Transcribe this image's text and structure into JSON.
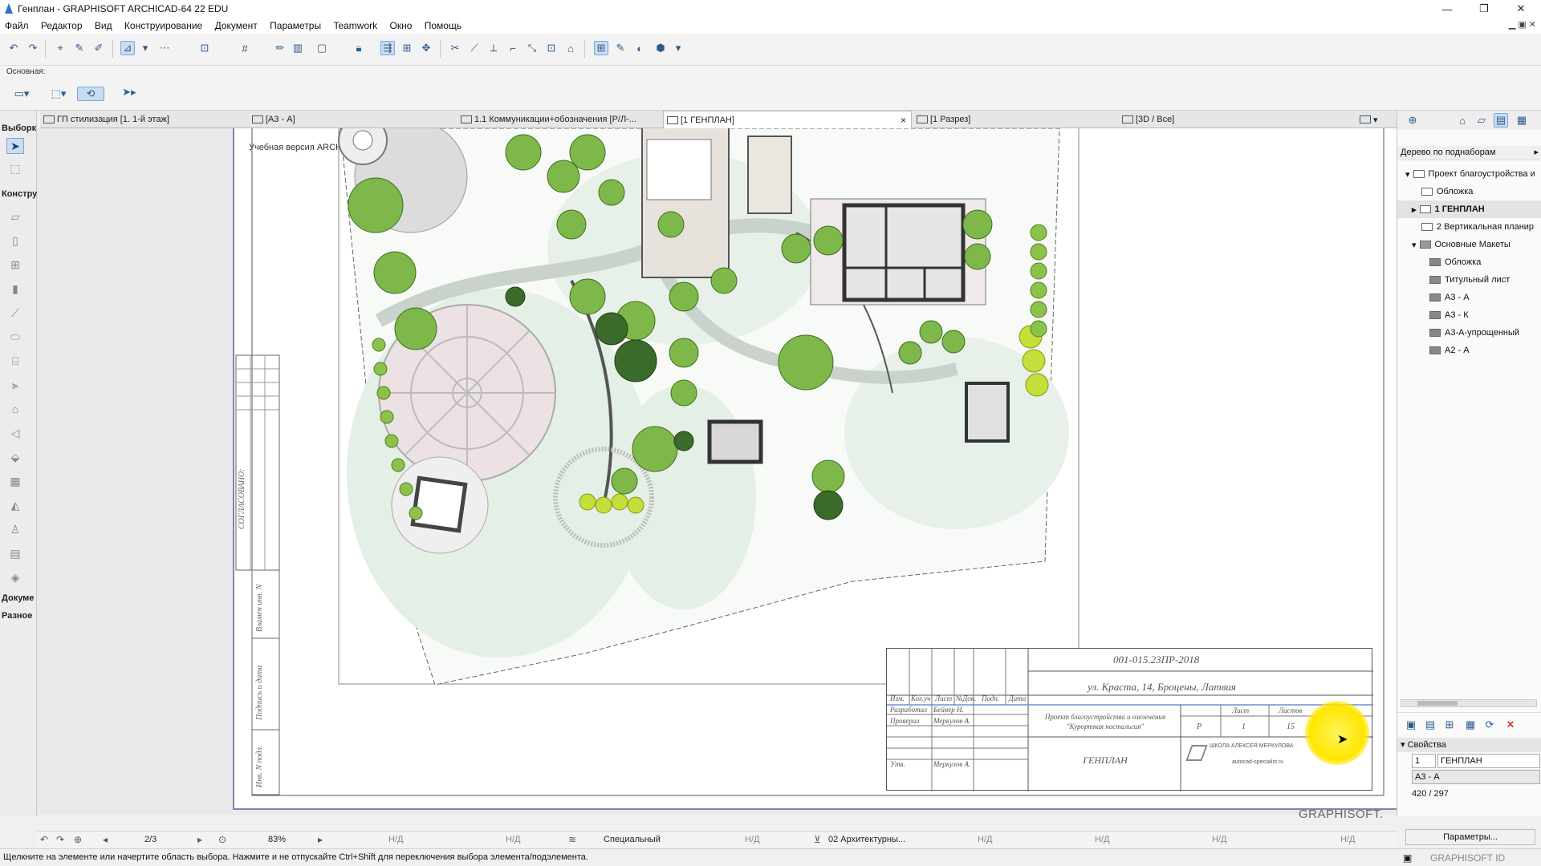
{
  "window": {
    "title": "Генплан - GRAPHISOFT ARCHICAD-64 22 EDU",
    "minimize": "—",
    "restore": "❐",
    "close": "✕"
  },
  "menu": {
    "items": [
      "Файл",
      "Редактор",
      "Вид",
      "Конструирование",
      "Документ",
      "Параметры",
      "Teamwork",
      "Окно",
      "Помощь"
    ]
  },
  "infobox": {
    "label": "Основная:"
  },
  "tabs": [
    {
      "label": "ГП стилизация [1. 1-й этаж]"
    },
    {
      "label": "[А3 - А]"
    },
    {
      "label": "1.1 Коммуникации+обозначения [Р/Л-..."
    },
    {
      "label": "[1 ГЕНПЛАН]",
      "close": "×"
    },
    {
      "label": "[1 Разрез]"
    },
    {
      "label": "[3D / Все]"
    }
  ],
  "toolbox": {
    "selection_label": "Выборк",
    "design_label": "Констру",
    "document_label": "Докуме",
    "misc_label": "Разное"
  },
  "canvas": {
    "watermark": "Учебная версия ARCHICAD, не для продажи. В порядке любезности GRAPHISOFT.",
    "logo": "GRAPHISOFT."
  },
  "drawing": {
    "side_labels": [
      "СОГЛАСОВАНО:",
      "Взамен инв. N",
      "Подпись и дата",
      "Инв. N подл."
    ],
    "stamp": {
      "code": "001-015.23ПР-2018",
      "address": "ул. Краста, 14, Броцены, Латвия",
      "headers": [
        "Изм.",
        "Кол.уч",
        "Лист",
        "№Док.",
        "Подп.",
        "Дата"
      ],
      "rows": [
        {
          "role": "Разработал",
          "name": "Бейнер Н."
        },
        {
          "role": "Проверил",
          "name": "Меркулов А."
        },
        {
          "role": "Утв.",
          "name": "Меркулов А."
        }
      ],
      "project_line1": "Проект благоустройства и озеленения",
      "project_line2": "\"Курортная ностальгия\"",
      "sheet_name": "ГЕНПЛАН",
      "stage_header": "",
      "stage": "Р",
      "sheet_header": "Лист",
      "sheet_no": "1",
      "sheets_header": "Листов",
      "sheets_total": "15",
      "school_name": "ШКОЛА АЛЕКСЕЯ МЕРКУЛОВА",
      "school_url": "autocad-specialist.ru"
    }
  },
  "navigator": {
    "mode": "Дерево по поднаборам",
    "items": [
      {
        "label": "Проект благоустройства и",
        "level": 0
      },
      {
        "label": "Обложка",
        "level": 1
      },
      {
        "label": "1 ГЕНПЛАН",
        "level": 1,
        "selected": true
      },
      {
        "label": "2 Вертикальная планир",
        "level": 1
      },
      {
        "label": "Основные Макеты",
        "level": 1
      },
      {
        "label": "Обложка",
        "level": 2
      },
      {
        "label": "Титульный лист",
        "level": 2
      },
      {
        "label": "А3 - А",
        "level": 2
      },
      {
        "label": "А3 - К",
        "level": 2
      },
      {
        "label": "А3-А-упрощенный",
        "level": 2
      },
      {
        "label": "А2 - А",
        "level": 2
      }
    ]
  },
  "properties": {
    "header": "Свойства",
    "id_value": "1",
    "name_value": "ГЕНПЛАН",
    "layout_value": "А3 - А",
    "size_value": "420 / 297",
    "params_button": "Параметры..."
  },
  "navbar": {
    "page": "2/3",
    "zoom": "83%",
    "na": "Н/Д",
    "pen_set": "Специальный",
    "layer_combo": "02 Архитектурны..."
  },
  "status": {
    "message": "Щелкните на элементе или начертите область выбора. Нажмите и не отпускайте Ctrl+Shift для переключения выбора элемента/подэлемента.",
    "graphisoft_id": "GRAPHISOFT ID"
  }
}
